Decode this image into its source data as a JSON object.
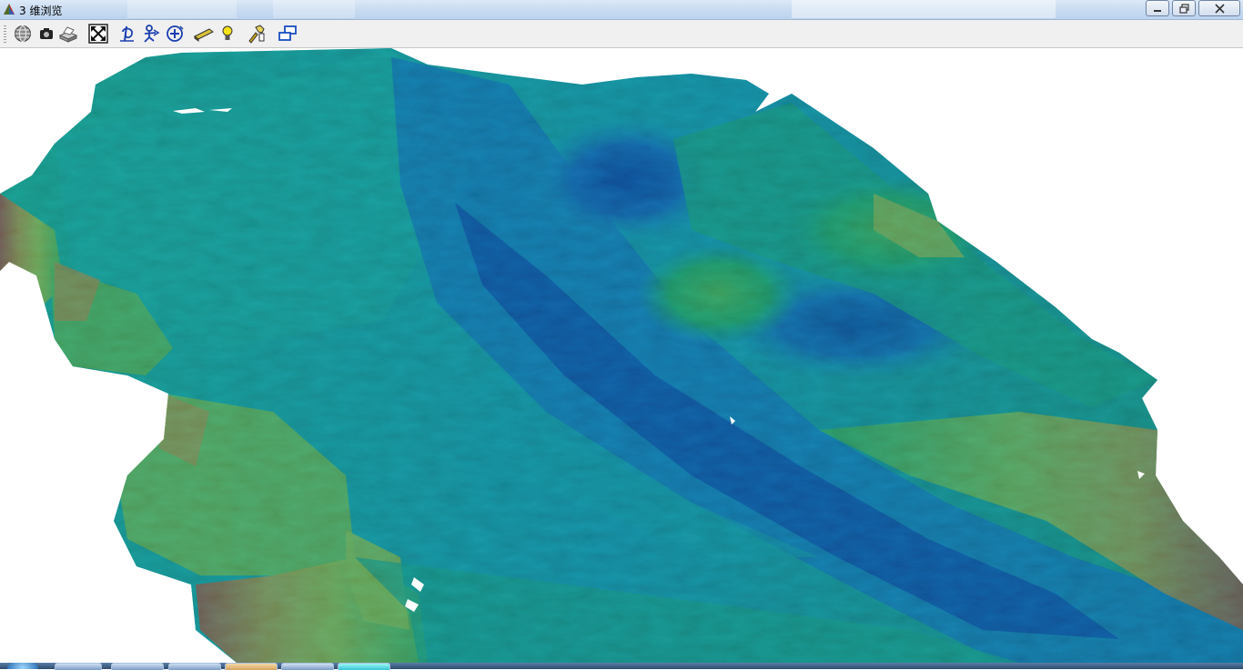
{
  "window": {
    "title": "3 维浏览",
    "buttons": {
      "minimize_icon": "minimize-icon",
      "restore_icon": "restore-icon",
      "close_icon": "close-icon"
    }
  },
  "toolbar": {
    "tools": [
      {
        "name": "globe-tool-button",
        "icon": "globe-icon"
      },
      {
        "name": "snapshot-tool-button",
        "icon": "camera-icon"
      },
      {
        "name": "print-tool-button",
        "icon": "printer-icon"
      },
      {
        "name": "full-extent-tool-button",
        "icon": "expand-arrows-icon"
      },
      {
        "name": "rotate-tool-button",
        "icon": "rotate-icon"
      },
      {
        "name": "pan-tool-button",
        "icon": "pan-person-icon"
      },
      {
        "name": "zoom-tool-button",
        "icon": "zoom-in-icon"
      },
      {
        "name": "surface-tool-button",
        "icon": "tablet-icon"
      },
      {
        "name": "light-tool-button",
        "icon": "lightbulb-icon"
      },
      {
        "name": "settings-tool-button",
        "icon": "tool-hand-icon"
      },
      {
        "name": "window-layout-tool-button",
        "icon": "windows-icon"
      }
    ]
  },
  "scene": {
    "type": "3d-bathymetry-surface",
    "colors": {
      "deep": "#0a1fb0",
      "mid_deep": "#1a5fd0",
      "shallow_blue": "#1aa9c9",
      "teal": "#13a39b",
      "green": "#2fb64a",
      "yellow_green": "#a7cf2a",
      "yellow": "#e2c81c",
      "orange": "#f08a1c",
      "red": "#e23a14",
      "background": "#ffffff"
    }
  },
  "taskbar": {
    "accent": "#2f4b6f"
  }
}
